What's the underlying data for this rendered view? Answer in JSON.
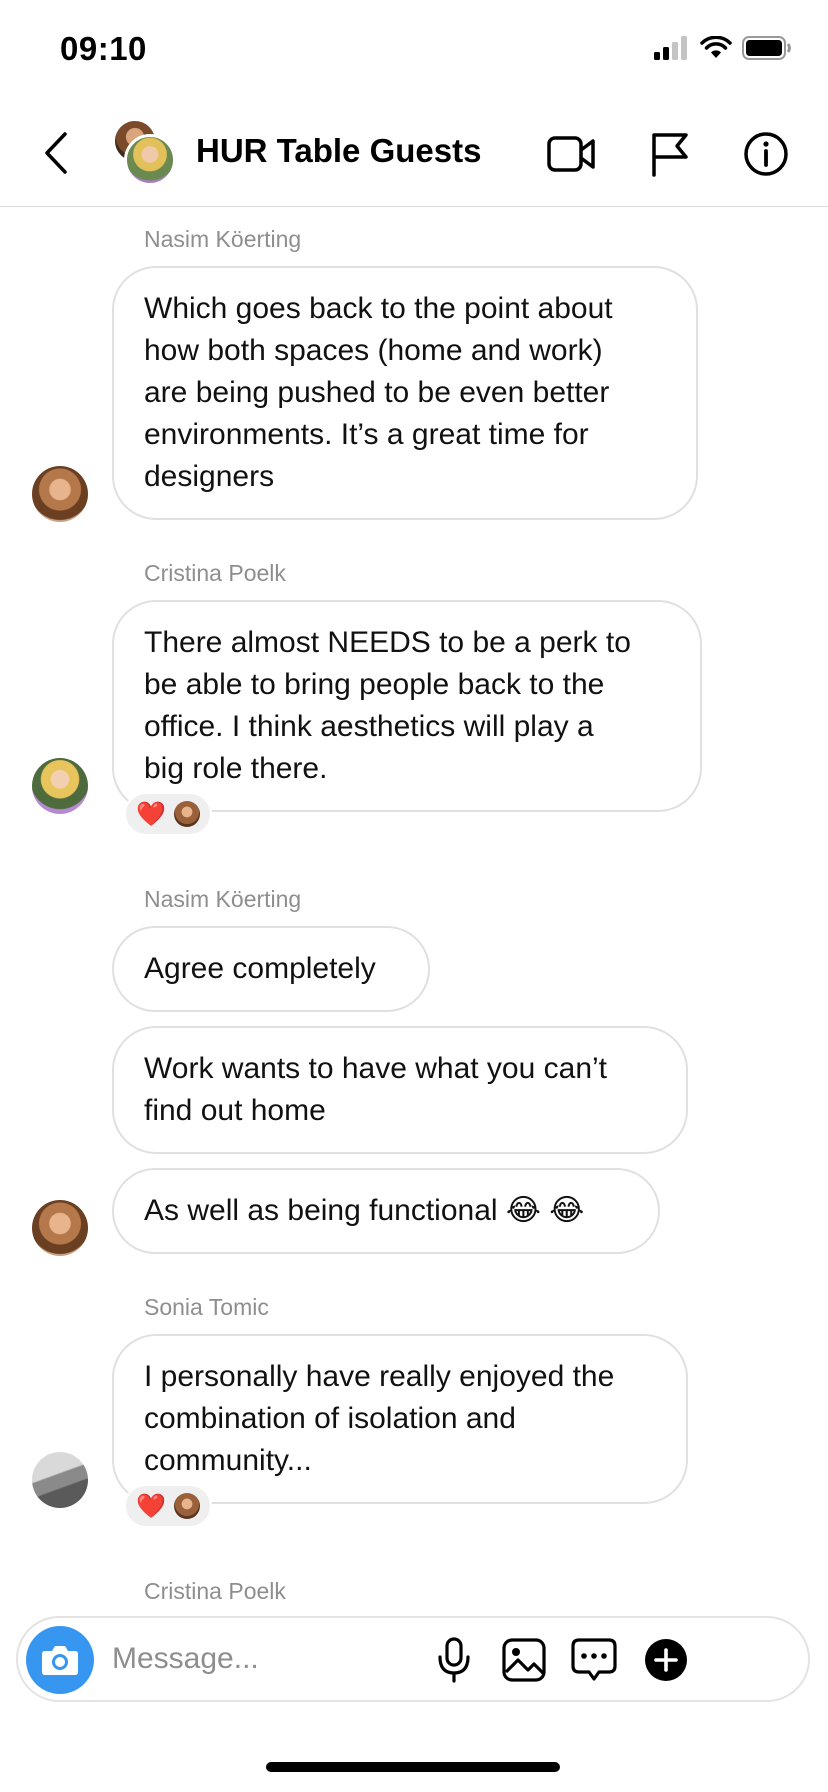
{
  "status_bar": {
    "time": "09:10"
  },
  "header": {
    "title": "HUR Table Guests"
  },
  "messages": [
    {
      "sender": "Nasim Köerting",
      "bubbles": [
        "Which goes back to the point about\nhow both spaces (home and work)\nare being pushed to be even better\nenvironments. It’s a great time for\ndesigners"
      ]
    },
    {
      "sender": "Cristina Poelk",
      "bubbles": [
        "There almost NEEDS to be a perk to\nbe able to bring people back to the\noffice. I think aesthetics will play a\nbig role there."
      ],
      "reaction": "❤️"
    },
    {
      "sender": "Nasim Köerting",
      "bubbles": [
        "Agree completely",
        "Work wants to have what you can’t\nfind out home",
        "As well as being functional 😂 😂"
      ]
    },
    {
      "sender": "Sonia Tomic",
      "bubbles": [
        "I personally have really enjoyed the\ncombination of isolation and\ncommunity..."
      ],
      "reaction": "❤️"
    },
    {
      "sender": "Cristina Poelk",
      "bubbles": []
    }
  ],
  "composer": {
    "placeholder": "Message..."
  },
  "colors": {
    "accent": "#3797f0",
    "bubble_border": "#e0e0e0",
    "sender_gray": "#8e8e8e"
  }
}
